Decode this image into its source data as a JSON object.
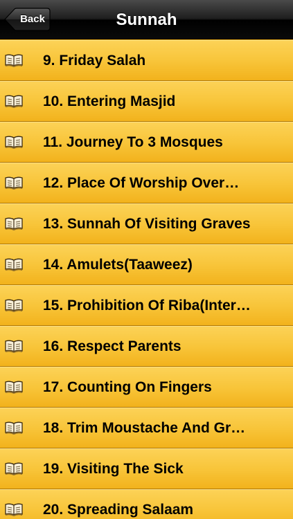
{
  "navbar": {
    "back_label": "Back",
    "title": "Sunnah"
  },
  "list": {
    "icon": "open-book-icon",
    "items": [
      {
        "label": "9. Friday Salah"
      },
      {
        "label": "10. Entering Masjid"
      },
      {
        "label": "11. Journey To 3 Mosques"
      },
      {
        "label": "12. Place Of Worship Over…"
      },
      {
        "label": "13. Sunnah Of Visiting Graves"
      },
      {
        "label": "14. Amulets(Taaweez)"
      },
      {
        "label": "15. Prohibition Of Riba(Inter…"
      },
      {
        "label": "16. Respect Parents"
      },
      {
        "label": "17. Counting On Fingers"
      },
      {
        "label": "18. Trim Moustache And Gr…"
      },
      {
        "label": "19. Visiting The Sick"
      },
      {
        "label": "20. Spreading Salaam"
      }
    ]
  },
  "colors": {
    "row_top": "#fcd257",
    "row_bottom": "#f2b21c",
    "navbar": "#1e1e1e"
  }
}
